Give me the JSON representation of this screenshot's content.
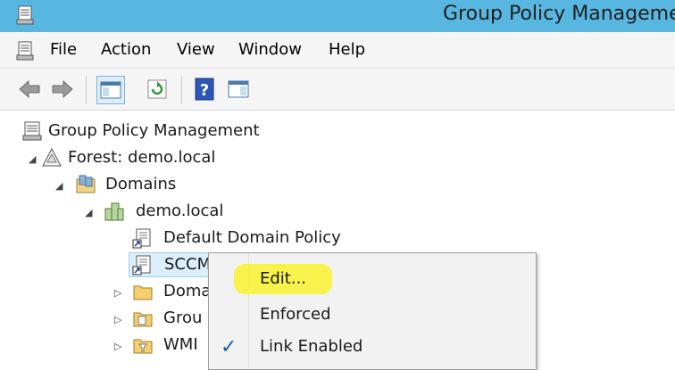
{
  "window": {
    "title": "Group Policy Manageme"
  },
  "menu": {
    "items": [
      {
        "label": "File"
      },
      {
        "label": "Action"
      },
      {
        "label": "View"
      },
      {
        "label": "Window"
      },
      {
        "label": "Help"
      }
    ]
  },
  "toolbar": {
    "buttons": [
      "back-icon",
      "forward-icon",
      "show-hide-tree-icon",
      "refresh-icon",
      "help-icon",
      "properties-icon"
    ]
  },
  "tree": {
    "root": "Group Policy Management",
    "forest": "Forest: demo.local",
    "domains": "Domains",
    "domain": "demo.local",
    "gpo_default": "Default Domain Policy",
    "gpo_sccm": "SCCM_CC",
    "domain_controllers": "Doma",
    "group_policy_objects": "Grou",
    "wmi": "WMI"
  },
  "context_menu": {
    "edit": "Edit...",
    "enforced": "Enforced",
    "link_enabled": "Link Enabled",
    "link_enabled_checked": true
  },
  "colors": {
    "titlebar": "#57b7e1",
    "highlight": "#f7f23a",
    "check": "#1b5fb5"
  }
}
